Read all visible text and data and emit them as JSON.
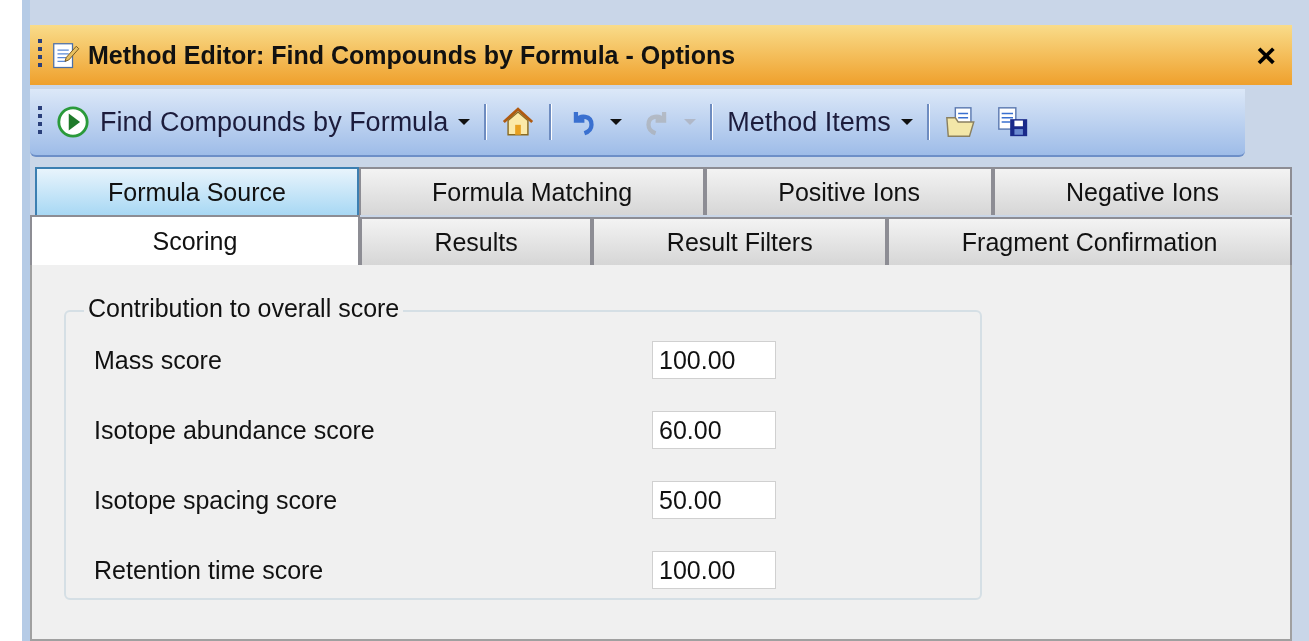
{
  "window": {
    "title": "Method Editor: Find Compounds by Formula - Options",
    "close": "×"
  },
  "toolbar": [
    {
      "kind": "run",
      "label": "Find Compounds by Formula",
      "dropdown": true,
      "disabled": false
    },
    {
      "kind": "home",
      "dropdown": false,
      "disabled": false
    },
    {
      "kind": "undo",
      "dropdown": true,
      "disabled": false
    },
    {
      "kind": "redo",
      "dropdown": true,
      "disabled": true
    },
    {
      "kind": "menu",
      "label": "Method Items",
      "dropdown": true,
      "disabled": false
    },
    {
      "kind": "open",
      "dropdown": false,
      "disabled": false
    },
    {
      "kind": "save",
      "dropdown": false,
      "disabled": false
    }
  ],
  "tab_rows": [
    [
      {
        "label": "Formula Source",
        "selected": false,
        "highlighted": true
      },
      {
        "label": "Formula Matching",
        "selected": false,
        "highlighted": false
      },
      {
        "label": "Positive Ions",
        "selected": false,
        "highlighted": false
      },
      {
        "label": "Negative Ions",
        "selected": false,
        "highlighted": false
      }
    ],
    [
      {
        "label": "Scoring",
        "selected": true,
        "highlighted": false
      },
      {
        "label": "Results",
        "selected": false,
        "highlighted": false
      },
      {
        "label": "Result Filters",
        "selected": false,
        "highlighted": false
      },
      {
        "label": "Fragment Confirmation",
        "selected": false,
        "highlighted": false
      }
    ]
  ],
  "group": {
    "title": "Contribution to overall score",
    "fields": [
      {
        "label": "Mass score",
        "value": "100.00"
      },
      {
        "label": "Isotope abundance score",
        "value": "60.00"
      },
      {
        "label": "Isotope spacing score",
        "value": "50.00"
      },
      {
        "label": "Retention time score",
        "value": "100.00"
      }
    ]
  }
}
